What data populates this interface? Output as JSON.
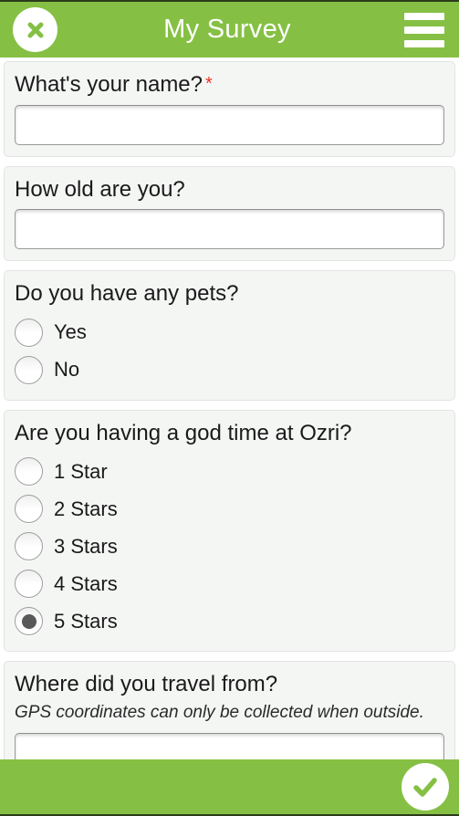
{
  "header": {
    "title": "My Survey",
    "close_icon": "close-x-icon",
    "menu_icon": "hamburger-menu-icon",
    "background_color": "#85c044"
  },
  "questions": [
    {
      "id": "name",
      "title": "What's your name?",
      "required": true,
      "required_marker": "*",
      "type": "text",
      "value": "",
      "placeholder": ""
    },
    {
      "id": "age",
      "title": "How old are you?",
      "required": false,
      "required_marker": "",
      "type": "text",
      "value": "",
      "placeholder": ""
    },
    {
      "id": "pets",
      "title": "Do you have any pets?",
      "required": false,
      "required_marker": "",
      "type": "radio",
      "options": [
        {
          "label": "Yes",
          "selected": false
        },
        {
          "label": "No",
          "selected": false
        }
      ]
    },
    {
      "id": "rating",
      "title": "Are you having a god time at Ozri?",
      "required": false,
      "required_marker": "",
      "type": "radio",
      "options": [
        {
          "label": "1 Star",
          "selected": false
        },
        {
          "label": "2 Stars",
          "selected": false
        },
        {
          "label": "3 Stars",
          "selected": false
        },
        {
          "label": "4 Stars",
          "selected": false
        },
        {
          "label": "5 Stars",
          "selected": true
        }
      ]
    },
    {
      "id": "travel-from",
      "title": "Where did you travel from?",
      "required": false,
      "required_marker": "",
      "hint": "GPS coordinates can only be collected when outside.",
      "type": "text",
      "value": "",
      "placeholder": ""
    }
  ],
  "footer": {
    "submit_icon": "checkmark-icon",
    "background_color": "#85c044"
  }
}
